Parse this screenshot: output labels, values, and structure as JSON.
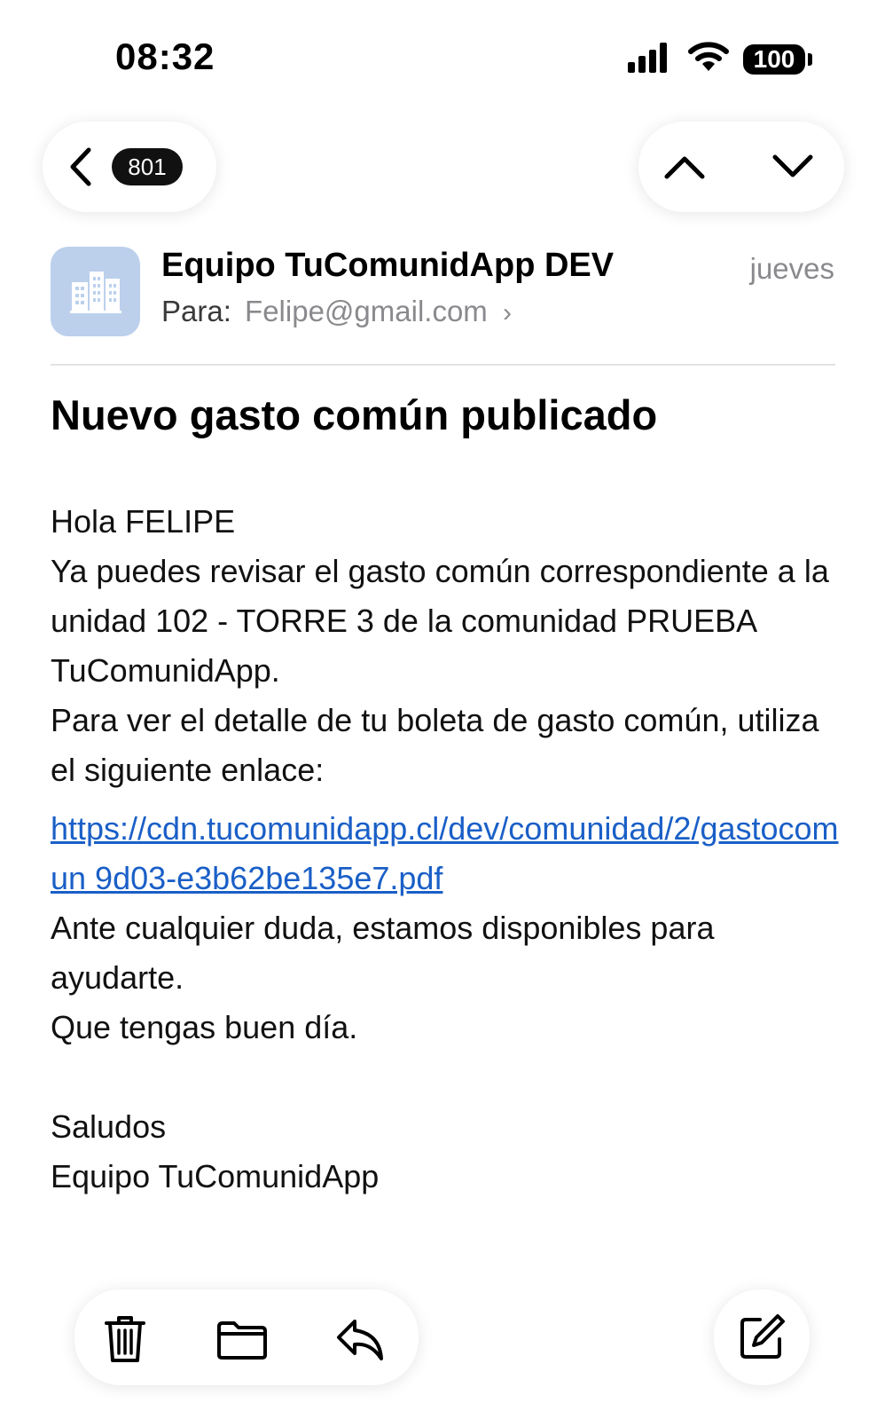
{
  "status_bar": {
    "time": "08:32",
    "battery": "100"
  },
  "nav": {
    "message_count": "801"
  },
  "email": {
    "sender": "Equipo TuComunidApp DEV",
    "date": "jueves",
    "to_label": "Para:",
    "to_address": "Felipe@gmail.com",
    "subject": "Nuevo gasto común publicado",
    "greeting": "Hola FELIPE",
    "paragraph1": "Ya puedes revisar el gasto común correspondiente a la unidad 102 - TORRE 3 de la comunidad PRUEBA TuComunidApp.",
    "paragraph2": "Para ver el detalle de tu boleta de gasto común, utiliza el siguiente enlace:",
    "link": "https://cdn.tucomunidapp.cl/dev/comunidad/2/gastocomun 9d03-e3b62be135e7.pdf",
    "paragraph3": "Ante cualquier duda, estamos disponibles para ayudarte.",
    "paragraph4": "Que tengas buen día.",
    "closing": "Saludos",
    "signature": "Equipo TuComunidApp"
  },
  "colors": {
    "link": "#1a5fc7",
    "avatar_bg": "#bcd0ec",
    "muted": "#8a8a8e"
  },
  "icons": {
    "back": "chevron-left-icon",
    "previous": "chevron-up-icon",
    "next": "chevron-down-icon",
    "avatar": "buildings-icon",
    "delete": "trash-icon",
    "move": "folder-icon",
    "reply": "reply-icon",
    "compose": "compose-icon"
  }
}
